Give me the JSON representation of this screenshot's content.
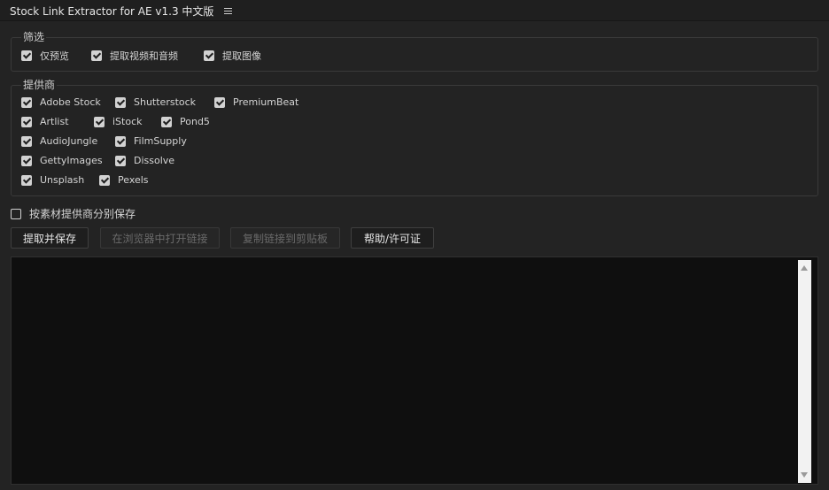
{
  "window": {
    "title": "Stock Link Extractor for AE v1.3 中文版"
  },
  "filter": {
    "legend": "筛选",
    "options": [
      {
        "label": "仅预览",
        "checked": true
      },
      {
        "label": "提取视频和音频",
        "checked": true
      },
      {
        "label": "提取图像",
        "checked": true
      }
    ]
  },
  "providers": {
    "legend": "提供商",
    "items": [
      {
        "label": "Adobe Stock",
        "checked": true
      },
      {
        "label": "Shutterstock",
        "checked": true
      },
      {
        "label": "PremiumBeat",
        "checked": true
      },
      {
        "label": "Artlist",
        "checked": true
      },
      {
        "label": "iStock",
        "checked": true
      },
      {
        "label": "Pond5",
        "checked": true
      },
      {
        "label": "AudioJungle",
        "checked": true
      },
      {
        "label": "FilmSupply",
        "checked": true
      },
      {
        "label": "GettyImages",
        "checked": true
      },
      {
        "label": "Dissolve",
        "checked": true
      },
      {
        "label": "Unsplash",
        "checked": true
      },
      {
        "label": "Pexels",
        "checked": true
      }
    ]
  },
  "save_by_provider": {
    "label": "按素材提供商分别保存",
    "checked": false
  },
  "buttons": {
    "extract_save": "提取并保存",
    "open_browser": "在浏览器中打开链接",
    "copy_clipboard": "复制链接到剪贴板",
    "help_license": "帮助/许可证"
  },
  "colors": {
    "background": "#232323",
    "output_bg": "#0f0f0f",
    "text": "#cfcfcf"
  }
}
